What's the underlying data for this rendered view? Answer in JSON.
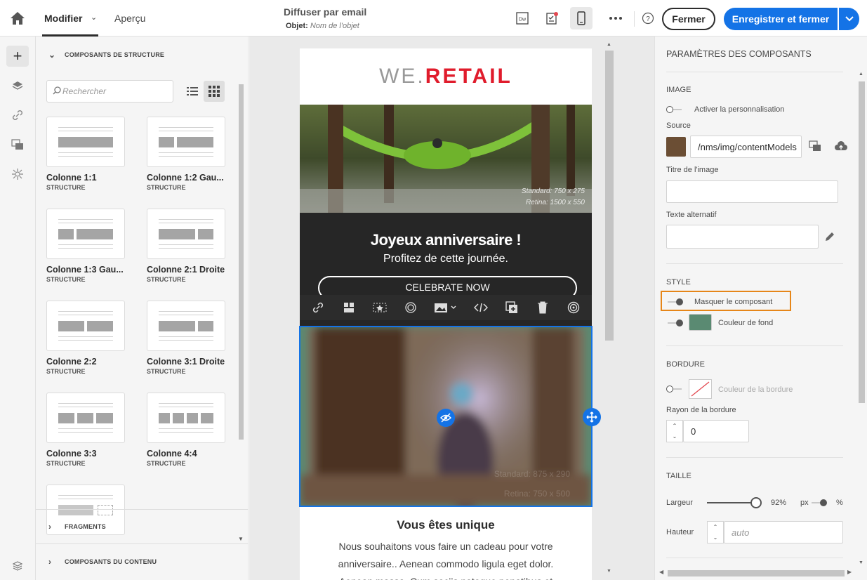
{
  "topbar": {
    "tab_modifier": "Modifier",
    "tab_apercu": "Aperçu",
    "title": "Diffuser par email",
    "subject_label": "Objet:",
    "subject_placeholder": "Nom de l'objet",
    "icon_dw": "Dw",
    "close_label": "Fermer",
    "save_label": "Enregistrer et fermer",
    "accent": "#1473e6"
  },
  "left_panel": {
    "structure_title": "COMPOSANTS DE STRUCTURE",
    "search_placeholder": "Rechercher",
    "components": [
      {
        "title": "Colonne 1:1",
        "sub": "STRUCTURE"
      },
      {
        "title": "Colonne 1:2 Gau...",
        "sub": "STRUCTURE"
      },
      {
        "title": "Colonne 1:3 Gau...",
        "sub": "STRUCTURE"
      },
      {
        "title": "Colonne 2:1 Droite",
        "sub": "STRUCTURE"
      },
      {
        "title": "Colonne 2:2",
        "sub": "STRUCTURE"
      },
      {
        "title": "Colonne 3:1 Droite",
        "sub": "STRUCTURE"
      },
      {
        "title": "Colonne 3:3",
        "sub": "STRUCTURE"
      },
      {
        "title": "Colonne 4:4",
        "sub": "STRUCTURE"
      }
    ],
    "fragments_title": "FRAGMENTS",
    "content_title": "COMPOSANTS DU CONTENU"
  },
  "email": {
    "logo_a": "WE.",
    "logo_b": "RETAIL",
    "hero_std": "Standard: 750 x 275",
    "hero_ret": "Retina: 1500 x 550",
    "headline": "Joyeux anniversaire !",
    "subline": "Profitez de cette journée.",
    "cta": "CELEBRATE NOW",
    "img2_std": "Standard: 875 x 290",
    "img2_ret": "Retina: 750 x 500",
    "unique_title": "Vous êtes unique",
    "lorem": "Nous souhaitons vous faire un cadeau pour votre anniversaire.. Aenean commodo ligula eget dolor. Aenean massa. Cum sociis natoque penatibus et"
  },
  "right_panel": {
    "title": "PARAMÈTRES DES COMPOSANTS",
    "image_section": "IMAGE",
    "personalization": "Activer la personnalisation",
    "source_label": "Source",
    "source_value": "/nms/img/contentModels",
    "image_title_label": "Titre de l'image",
    "alt_label": "Texte alternatif",
    "style_section": "STYLE",
    "hide_component": "Masquer le composant",
    "bg_color_label": "Couleur de fond",
    "bg_color": "#5a8a72",
    "border_section": "BORDURE",
    "border_color_label": "Couleur de la bordure",
    "border_radius_label": "Rayon de la bordure",
    "border_radius_value": "0",
    "size_section": "TAILLE",
    "width_label": "Largeur",
    "width_value": "92%",
    "width_unit": "px",
    "width_unit_alt": "%",
    "height_label": "Hauteur",
    "height_placeholder": "auto"
  }
}
